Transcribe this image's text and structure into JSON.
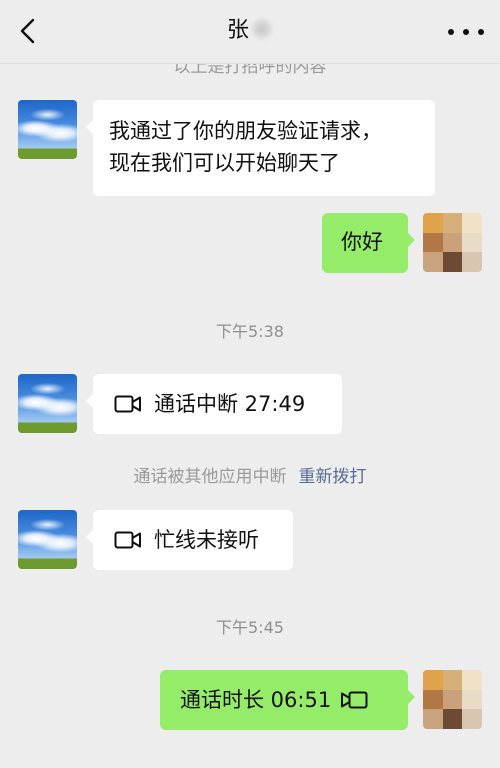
{
  "header": {
    "back_icon": "chevron-left-icon",
    "title": "张",
    "more_icon": "more-dots-icon"
  },
  "cut_notice": "以上是打招呼的内容",
  "messages": [
    {
      "side": "left",
      "lines": [
        "我通过了你的朋友验证请求，",
        "现在我们可以开始聊天了"
      ]
    },
    {
      "side": "right",
      "text": "你好"
    },
    {
      "timestamp": "下午5:38"
    },
    {
      "side": "left",
      "icon": "video-call-icon",
      "text": "通话中断 27:49"
    },
    {
      "system": "通话被其他应用中断",
      "action": "重新拨打"
    },
    {
      "side": "left",
      "icon": "video-call-icon",
      "text": "忙线未接听"
    },
    {
      "timestamp": "下午5:45"
    },
    {
      "side": "right",
      "icon": "video-call-icon",
      "text": "通话时长 06:51"
    }
  ],
  "colors": {
    "background": "#ededed",
    "incoming_bubble": "#ffffff",
    "outgoing_bubble": "#95ec69",
    "link": "#576b95",
    "muted_text": "#8f8f8f"
  }
}
